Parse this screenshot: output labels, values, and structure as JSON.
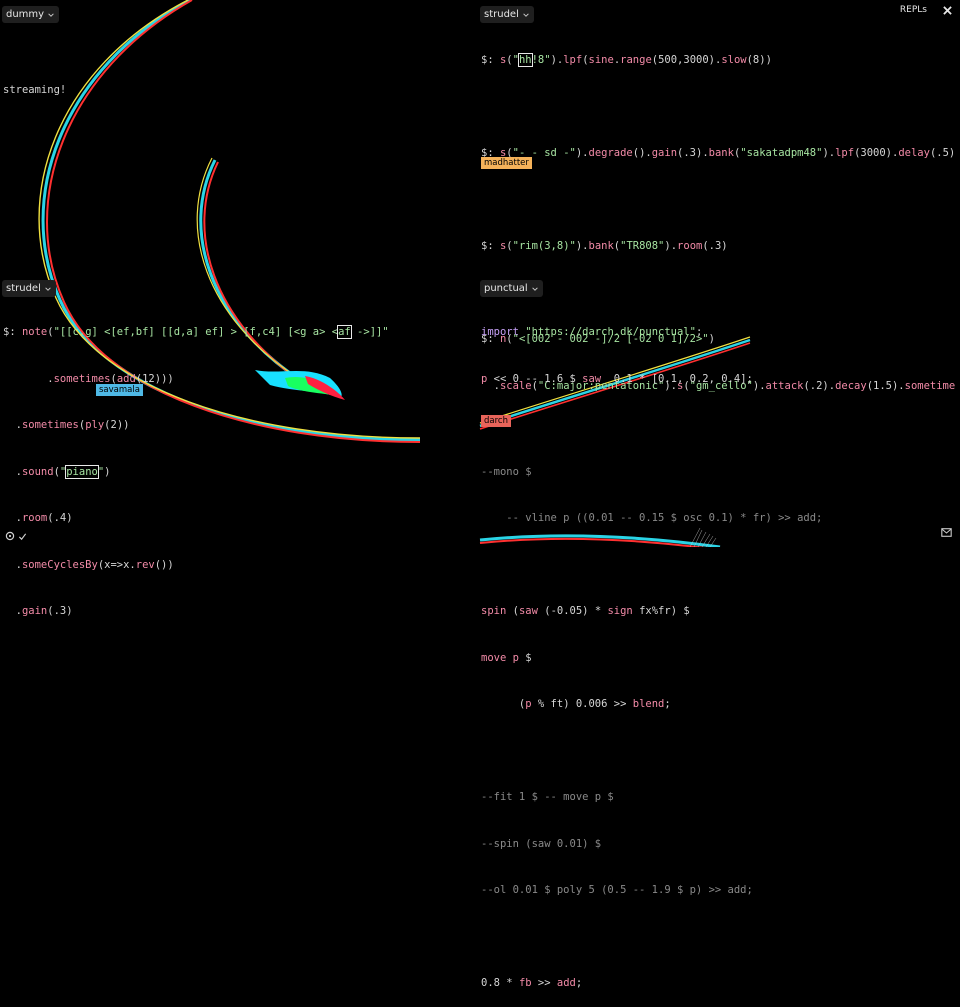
{
  "panes": {
    "dummy": {
      "tab": "dummy",
      "streaming": "streaming!"
    },
    "strudel_top": {
      "tab": "strudel",
      "lines": [
        "$: s(\"hh!8\").lpf(sine.range(500,3000).slow(8))",
        "",
        "$: s(\"- - sd -\").degrade().gain(.3).bank(\"sakatadpm48\").lpf(3000).delay(.5)",
        "",
        "$: s(\"rim(3,8)\").bank(\"TR808\").room(.3)",
        "",
        "$: n(\"<[002 - 002 -]/2 [-02 0 1]/2>\")",
        "  .scale(\"C:major:pentatonic\").s(\"gm_cello\").attack(.2).decay(1.5).sometime"
      ],
      "cursor_label": "madhatter"
    },
    "strudel_bottom": {
      "tab": "strudel",
      "lines": [
        "$: note(\"[[c,g] <[ef,bf] [[d,a] ef] > [f,c4] [<g a> <af ->]]\"",
        "       .sometimes(add(12)))",
        "  .sometimes(ply(2))",
        "  .sound(\"piano\")",
        "  .room(.4)",
        "  .someCyclesBy(x=>x.rev())",
        "  .gain(.3)"
      ],
      "cursor_label": "savamala"
    },
    "punctual": {
      "tab": "punctual",
      "lines": [
        "import \"https://darch.dk/punctual\";",
        "p << 0 -- 1.6 $ saw  0.1 * [0.1, 0.2, 0.4];",
        "",
        "--mono $",
        "    -- vline p ((0.01 -- 0.15 $ osc 0.1) * fr) >> add;",
        "",
        "spin (saw (-0.05) * sign fx%fr) $",
        "move p $",
        "      (p % ft) 0.006 >> blend;",
        "",
        "--fit 1 $ -- move p $",
        "--spin (saw 0.01) $",
        "--ol 0.01 $ poly 5 (0.5 -- 1.9 $ p) >> add;",
        "",
        "0.8 * fb >> add;"
      ],
      "cursor_label": "darch"
    }
  },
  "header": {
    "repls_label": "REPLs",
    "close_icon": "close-icon"
  },
  "colors": {
    "madhatter": "#f5b25a",
    "savamala": "#4fb9e6",
    "darch": "#e8645a"
  }
}
